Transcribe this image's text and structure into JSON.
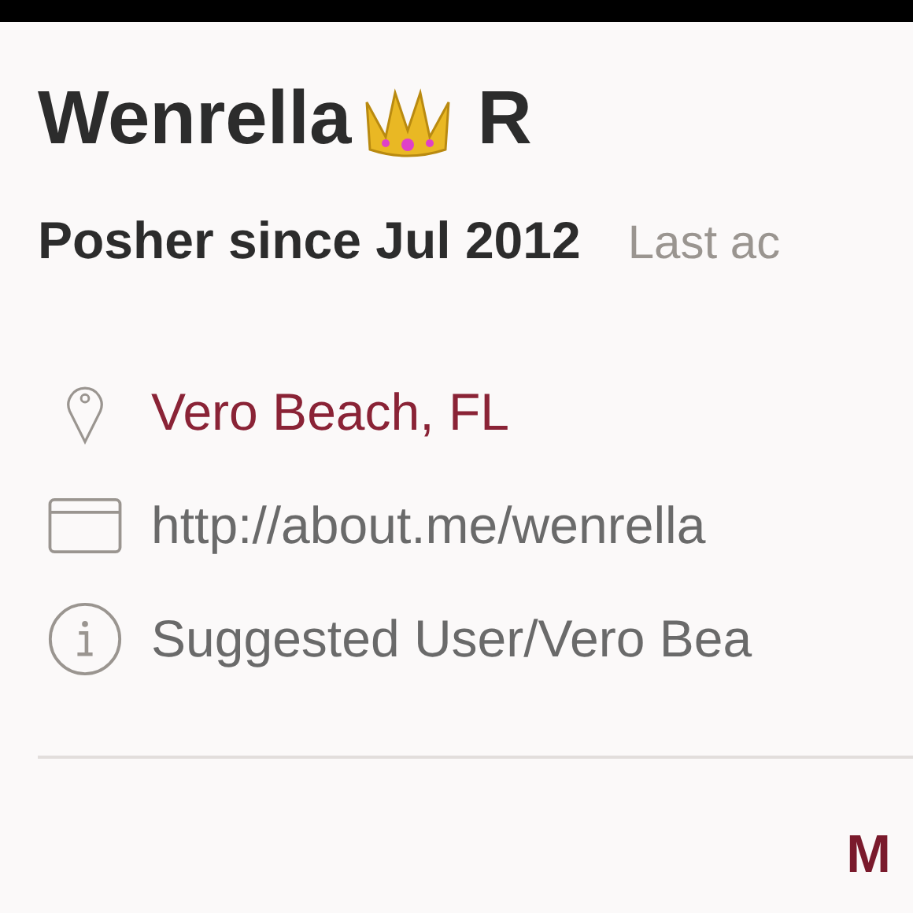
{
  "profile": {
    "first_name": "Wenrella",
    "last_name": "R",
    "badge": true
  },
  "tenure": {
    "since": "Posher since Jul 2012",
    "last_active": "Last ac"
  },
  "details": [
    {
      "kind": "location",
      "text": "Vero Beach, FL"
    },
    {
      "kind": "website",
      "text": "http://about.me/wenrella"
    },
    {
      "kind": "info",
      "text": "Suggested User/Vero Bea"
    }
  ],
  "more_link": "M"
}
